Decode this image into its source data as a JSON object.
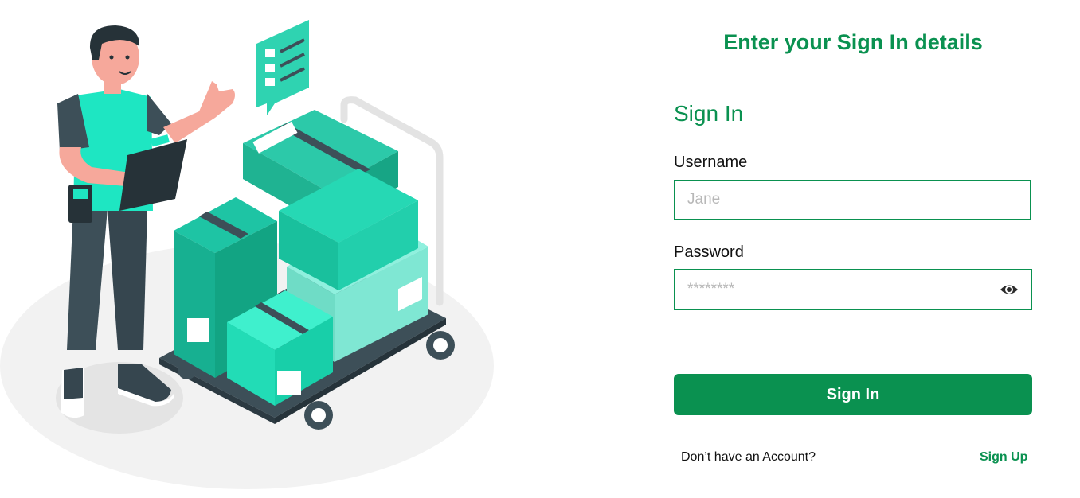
{
  "colors": {
    "brand_green": "#0a9150",
    "box_teal": "#1ec4a4"
  },
  "header": {
    "title": "Enter your Sign In details"
  },
  "form": {
    "section_title": "Sign In",
    "username_label": "Username",
    "username_placeholder": "Jane",
    "username_value": "",
    "password_label": "Password",
    "password_placeholder": "********",
    "password_value": "",
    "password_toggle_icon": "eye-icon",
    "submit_label": "Sign In"
  },
  "footer": {
    "prompt": "Don’t have an Account?",
    "signup_label": "Sign Up"
  }
}
